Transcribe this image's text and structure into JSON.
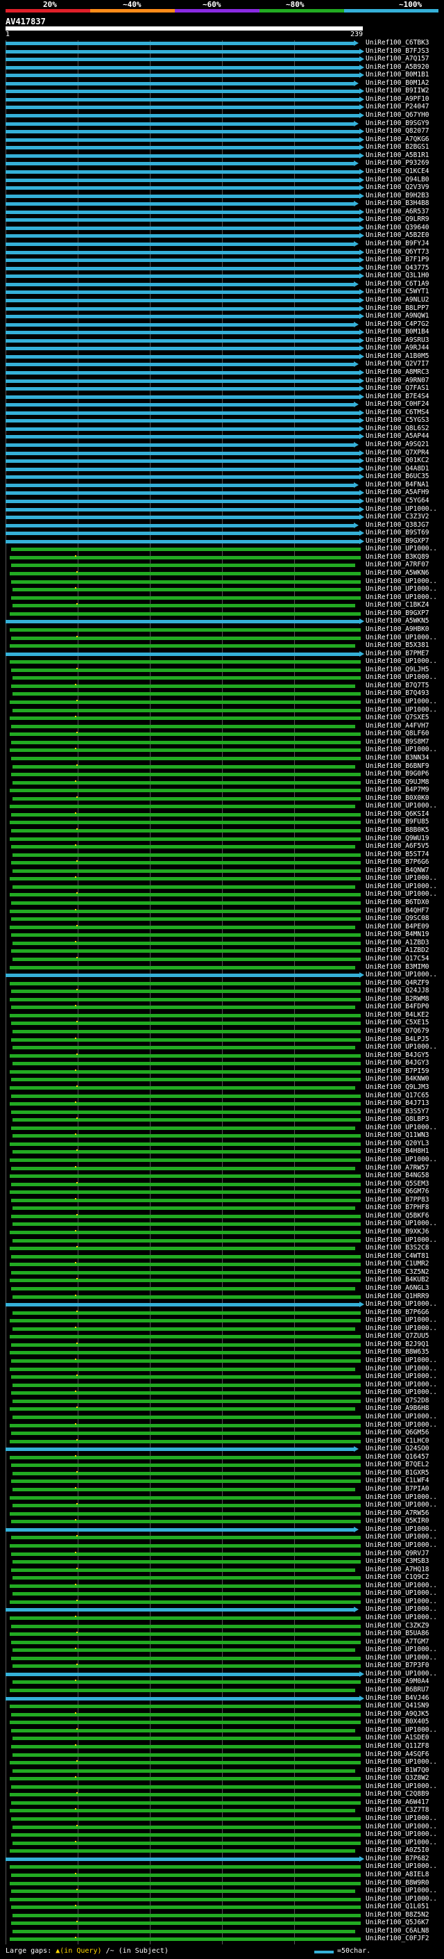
{
  "scale": {
    "labels": [
      "20%",
      "~40%",
      "~60%",
      "~80%",
      "~100%"
    ],
    "colors": [
      "#e0202a",
      "#ff8c1a",
      "#8a2be2",
      "#22aa22",
      "#35b0d8"
    ]
  },
  "query": {
    "id": "AV417837",
    "start_tick": "1",
    "end_tick": "239"
  },
  "legend": {
    "large_gaps": "Large gaps:",
    "in_query_symbol": "▲(in Query)",
    "in_subject_symbol": "/~ (in Subject)",
    "chars_label": "=50char."
  },
  "hits": [
    {
      "label": "UniRef100_C6TBK3",
      "identity": "~100%"
    },
    {
      "label": "UniRef100_B7FJS3",
      "identity": "~100%"
    },
    {
      "label": "UniRef100_A7Q157",
      "identity": "~100%"
    },
    {
      "label": "UniRef100_A5B920",
      "identity": "~100%"
    },
    {
      "label": "UniRef100_B0M1B1",
      "identity": "~100%"
    },
    {
      "label": "UniRef100_B0M1A2",
      "identity": "~100%"
    },
    {
      "label": "UniRef100_B9IIW2",
      "identity": "~100%"
    },
    {
      "label": "UniRef100_A9PF10",
      "identity": "~100%"
    },
    {
      "label": "UniRef100_P24047",
      "identity": "~100%"
    },
    {
      "label": "UniRef100_Q67YH0",
      "identity": "~100%"
    },
    {
      "label": "UniRef100_B9SGY9",
      "identity": "~100%"
    },
    {
      "label": "UniRef100_Q82077",
      "identity": "~100%"
    },
    {
      "label": "UniRef100_A7QKG6",
      "identity": "~100%"
    },
    {
      "label": "UniRef100_B2BGS1",
      "identity": "~100%"
    },
    {
      "label": "UniRef100_A5B1R1",
      "identity": "~100%"
    },
    {
      "label": "UniRef100_P93269",
      "identity": "~100%"
    },
    {
      "label": "UniRef100_Q1KCE4",
      "identity": "~100%"
    },
    {
      "label": "UniRef100_Q94LB0",
      "identity": "~100%"
    },
    {
      "label": "UniRef100_Q2V3V9",
      "identity": "~100%"
    },
    {
      "label": "UniRef100_B9H2B3",
      "identity": "~100%"
    },
    {
      "label": "UniRef100_B3H4B8",
      "identity": "~100%"
    },
    {
      "label": "UniRef100_A6R537",
      "identity": "~100%"
    },
    {
      "label": "UniRef100_Q9LRR9",
      "identity": "~100%"
    },
    {
      "label": "UniRef100_Q39640",
      "identity": "~100%"
    },
    {
      "label": "UniRef100_A5B2E0",
      "identity": "~100%"
    },
    {
      "label": "UniRef100_B9FYJ4",
      "identity": "~100%"
    },
    {
      "label": "UniRef100_Q6YT73",
      "identity": "~100%"
    },
    {
      "label": "UniRef100_B7F1P9",
      "identity": "~100%"
    },
    {
      "label": "UniRef100_Q43775",
      "identity": "~100%"
    },
    {
      "label": "UniRef100_Q3L1H0",
      "identity": "~100%"
    },
    {
      "label": "UniRef100_C6T1A9",
      "identity": "~100%"
    },
    {
      "label": "UniRef100_C5WYT1",
      "identity": "~100%"
    },
    {
      "label": "UniRef100_A9NLU2",
      "identity": "~100%"
    },
    {
      "label": "UniRef100_B8LPP7",
      "identity": "~100%"
    },
    {
      "label": "UniRef100_A9NQW1",
      "identity": "~100%"
    },
    {
      "label": "UniRef100_C4P7G2",
      "identity": "~100%"
    },
    {
      "label": "UniRef100_B0M1B4",
      "identity": "~100%"
    },
    {
      "label": "UniRef100_A9SRU3",
      "identity": "~100%"
    },
    {
      "label": "UniRef100_A9RJ44",
      "identity": "~100%"
    },
    {
      "label": "UniRef100_A1B0M5",
      "identity": "~100%"
    },
    {
      "label": "UniRef100_Q2V7I7",
      "identity": "~100%"
    },
    {
      "label": "UniRef100_A8MRC3",
      "identity": "~100%"
    },
    {
      "label": "UniRef100_A9RN07",
      "identity": "~100%"
    },
    {
      "label": "UniRef100_Q7FAS1",
      "identity": "~100%"
    },
    {
      "label": "UniRef100_B7E4S4",
      "identity": "~100%"
    },
    {
      "label": "UniRef100_C0HF24",
      "identity": "~100%"
    },
    {
      "label": "UniRef100_C6TMS4",
      "identity": "~100%"
    },
    {
      "label": "UniRef100_C5YGS3",
      "identity": "~100%"
    },
    {
      "label": "UniRef100_Q8L6S2",
      "identity": "~100%"
    },
    {
      "label": "UniRef100_A5AP44",
      "identity": "~100%"
    },
    {
      "label": "UniRef100_A9SQ21",
      "identity": "~100%"
    },
    {
      "label": "UniRef100_Q7XPR4",
      "identity": "~100%"
    },
    {
      "label": "UniRef100_Q01KC2",
      "identity": "~100%"
    },
    {
      "label": "UniRef100_Q4A8D1",
      "identity": "~100%"
    },
    {
      "label": "UniRef100_B6UC35",
      "identity": "~100%"
    },
    {
      "label": "UniRef100_B4FNA1",
      "identity": "~100%"
    },
    {
      "label": "UniRef100_A5AFH9",
      "identity": "~100%"
    },
    {
      "label": "UniRef100_C5YG64",
      "identity": "~100%"
    },
    {
      "label": "UniRef100_UP1000..",
      "identity": "~100%"
    },
    {
      "label": "UniRef100_C3Z3V2",
      "identity": "~100%"
    },
    {
      "label": "UniRef100_Q38JG7",
      "identity": "~100%"
    },
    {
      "label": "UniRef100_B9ST69",
      "identity": "~100%"
    },
    {
      "label": "UniRef100_B9GXP7",
      "identity": "~100%"
    },
    {
      "label": "UniRef100_UP1000..",
      "identity": "~80%"
    },
    {
      "label": "UniRef100_B3KQ89",
      "identity": "~80%"
    },
    {
      "label": "UniRef100_A7RF07",
      "identity": "~80%"
    },
    {
      "label": "UniRef100_A5WKN6",
      "identity": "~80%"
    },
    {
      "label": "UniRef100_UP1000..",
      "identity": "~80%"
    },
    {
      "label": "UniRef100_UP1000..",
      "identity": "~80%"
    },
    {
      "label": "UniRef100_UP1000..",
      "identity": "~80%"
    },
    {
      "label": "UniRef100_C1BKZ4",
      "identity": "~80%"
    },
    {
      "label": "UniRef100_B9GXP7",
      "identity": "~80%"
    },
    {
      "label": "UniRef100_A5WKN5",
      "identity": "~100%"
    },
    {
      "label": "UniRef100_A9HBK0",
      "identity": "~80%"
    },
    {
      "label": "UniRef100_UP1000..",
      "identity": "~80%"
    },
    {
      "label": "UniRef100_B5X381",
      "identity": "~80%"
    },
    {
      "label": "UniRef100_B7PME7",
      "identity": "~100%"
    },
    {
      "label": "UniRef100_UP1000..",
      "identity": "~80%"
    },
    {
      "label": "UniRef100_Q9LJH5",
      "identity": "~80%"
    },
    {
      "label": "UniRef100_UP1000..",
      "identity": "~80%"
    },
    {
      "label": "UniRef100_B7Q7T5",
      "identity": "~80%"
    },
    {
      "label": "UniRef100_B7Q493",
      "identity": "~80%"
    },
    {
      "label": "UniRef100_UP1000..",
      "identity": "~80%"
    },
    {
      "label": "UniRef100_UP1000..",
      "identity": "~80%"
    },
    {
      "label": "UniRef100_Q7SXE5",
      "identity": "~80%"
    },
    {
      "label": "UniRef100_A4FVH7",
      "identity": "~80%"
    },
    {
      "label": "UniRef100_Q8LF60",
      "identity": "~80%"
    },
    {
      "label": "UniRef100_B9S8M7",
      "identity": "~80%"
    },
    {
      "label": "UniRef100_UP1000..",
      "identity": "~80%"
    },
    {
      "label": "UniRef100_B3NN34",
      "identity": "~80%"
    },
    {
      "label": "UniRef100_B6BNF9",
      "identity": "~80%"
    },
    {
      "label": "UniRef100_B9G0P6",
      "identity": "~80%"
    },
    {
      "label": "UniRef100_Q9UJM8",
      "identity": "~80%"
    },
    {
      "label": "UniRef100_B4P7M9",
      "identity": "~80%"
    },
    {
      "label": "UniRef100_B0X0K0",
      "identity": "~80%"
    },
    {
      "label": "UniRef100_UP1000..",
      "identity": "~80%"
    },
    {
      "label": "UniRef100_Q6KSI4",
      "identity": "~80%"
    },
    {
      "label": "UniRef100_B9FU85",
      "identity": "~80%"
    },
    {
      "label": "UniRef100_B8B0K5",
      "identity": "~80%"
    },
    {
      "label": "UniRef100_Q9WU19",
      "identity": "~80%"
    },
    {
      "label": "UniRef100_A6F5V5",
      "identity": "~80%"
    },
    {
      "label": "UniRef100_B5ST74",
      "identity": "~80%"
    },
    {
      "label": "UniRef100_B7P6G6",
      "identity": "~80%"
    },
    {
      "label": "UniRef100_B4QNW7",
      "identity": "~80%"
    },
    {
      "label": "UniRef100_UP1000..",
      "identity": "~80%"
    },
    {
      "label": "UniRef100_UP1000..",
      "identity": "~80%"
    },
    {
      "label": "UniRef100_UP1000..",
      "identity": "~80%"
    },
    {
      "label": "UniRef100_B6TDX0",
      "identity": "~80%"
    },
    {
      "label": "UniRef100_B4QHF7",
      "identity": "~80%"
    },
    {
      "label": "UniRef100_Q9SC08",
      "identity": "~80%"
    },
    {
      "label": "UniRef100_B4PE09",
      "identity": "~80%"
    },
    {
      "label": "UniRef100_B4MN19",
      "identity": "~80%"
    },
    {
      "label": "UniRef100_A1ZBD3",
      "identity": "~80%"
    },
    {
      "label": "UniRef100_A1ZBD2",
      "identity": "~80%"
    },
    {
      "label": "UniRef100_Q17C54",
      "identity": "~80%"
    },
    {
      "label": "UniRef100_B3MIM0",
      "identity": "~80%"
    },
    {
      "label": "UniRef100_UP1000..",
      "identity": "~100%"
    },
    {
      "label": "UniRef100_Q4RZF9",
      "identity": "~80%"
    },
    {
      "label": "UniRef100_Q24JJ8",
      "identity": "~80%"
    },
    {
      "label": "UniRef100_B2RWM8",
      "identity": "~80%"
    },
    {
      "label": "UniRef100_B4FDP0",
      "identity": "~80%"
    },
    {
      "label": "UniRef100_B4LKE2",
      "identity": "~80%"
    },
    {
      "label": "UniRef100_C5XE15",
      "identity": "~80%"
    },
    {
      "label": "UniRef100_Q7Q679",
      "identity": "~80%"
    },
    {
      "label": "UniRef100_B4LPJ5",
      "identity": "~80%"
    },
    {
      "label": "UniRef100_UP1000..",
      "identity": "~80%"
    },
    {
      "label": "UniRef100_B4JGY5",
      "identity": "~80%"
    },
    {
      "label": "UniRef100_B4JGY3",
      "identity": "~80%"
    },
    {
      "label": "UniRef100_B7PI59",
      "identity": "~80%"
    },
    {
      "label": "UniRef100_B4KNW0",
      "identity": "~80%"
    },
    {
      "label": "UniRef100_Q9LJM3",
      "identity": "~80%"
    },
    {
      "label": "UniRef100_Q17C65",
      "identity": "~80%"
    },
    {
      "label": "UniRef100_B4J713",
      "identity": "~80%"
    },
    {
      "label": "UniRef100_B3S5Y7",
      "identity": "~80%"
    },
    {
      "label": "UniRef100_Q8LBP3",
      "identity": "~80%"
    },
    {
      "label": "UniRef100_UP1000..",
      "identity": "~80%"
    },
    {
      "label": "UniRef100_Q11WN3",
      "identity": "~80%"
    },
    {
      "label": "UniRef100_Q20YL3",
      "identity": "~80%"
    },
    {
      "label": "UniRef100_B4H8H1",
      "identity": "~80%"
    },
    {
      "label": "UniRef100_UP1000..",
      "identity": "~80%"
    },
    {
      "label": "UniRef100_A7RW57",
      "identity": "~80%"
    },
    {
      "label": "UniRef100_B4NG58",
      "identity": "~80%"
    },
    {
      "label": "UniRef100_Q5SEM3",
      "identity": "~80%"
    },
    {
      "label": "UniRef100_Q6GM76",
      "identity": "~80%"
    },
    {
      "label": "UniRef100_B7PP83",
      "identity": "~80%"
    },
    {
      "label": "UniRef100_B7PHF8",
      "identity": "~80%"
    },
    {
      "label": "UniRef100_Q5BKF6",
      "identity": "~80%"
    },
    {
      "label": "UniRef100_UP1000..",
      "identity": "~80%"
    },
    {
      "label": "UniRef100_B9XKJ6",
      "identity": "~80%"
    },
    {
      "label": "UniRef100_UP1000..",
      "identity": "~80%"
    },
    {
      "label": "UniRef100_B3S2C8",
      "identity": "~80%"
    },
    {
      "label": "UniRef100_C4WT81",
      "identity": "~80%"
    },
    {
      "label": "UniRef100_C1UMR2",
      "identity": "~80%"
    },
    {
      "label": "UniRef100_C3Z5N2",
      "identity": "~80%"
    },
    {
      "label": "UniRef100_B4KUB2",
      "identity": "~80%"
    },
    {
      "label": "UniRef100_A6NGL3",
      "identity": "~80%"
    },
    {
      "label": "UniRef100_Q1HRR9",
      "identity": "~80%"
    },
    {
      "label": "UniRef100_UP1000..",
      "identity": "~100%"
    },
    {
      "label": "UniRef100_B7P6G6",
      "identity": "~80%"
    },
    {
      "label": "UniRef100_UP1000..",
      "identity": "~80%"
    },
    {
      "label": "UniRef100_UP1000..",
      "identity": "~80%"
    },
    {
      "label": "UniRef100_Q7ZUU5",
      "identity": "~80%"
    },
    {
      "label": "UniRef100_B2J9Q1",
      "identity": "~80%"
    },
    {
      "label": "UniRef100_B8W635",
      "identity": "~80%"
    },
    {
      "label": "UniRef100_UP1000..",
      "identity": "~80%"
    },
    {
      "label": "UniRef100_UP1000..",
      "identity": "~80%"
    },
    {
      "label": "UniRef100_UP1000..",
      "identity": "~80%"
    },
    {
      "label": "UniRef100_UP1000..",
      "identity": "~80%"
    },
    {
      "label": "UniRef100_UP1000..",
      "identity": "~80%"
    },
    {
      "label": "UniRef100_Q7S2D8",
      "identity": "~80%"
    },
    {
      "label": "UniRef100_A9B6H8",
      "identity": "~80%"
    },
    {
      "label": "UniRef100_UP1000..",
      "identity": "~80%"
    },
    {
      "label": "UniRef100_UP1000..",
      "identity": "~80%"
    },
    {
      "label": "UniRef100_Q6GM56",
      "identity": "~80%"
    },
    {
      "label": "UniRef100_C1LHC0",
      "identity": "~80%"
    },
    {
      "label": "UniRef100_Q24SO0",
      "identity": "~100%"
    },
    {
      "label": "UniRef100_Q16457",
      "identity": "~80%"
    },
    {
      "label": "UniRef100_B7QEL2",
      "identity": "~80%"
    },
    {
      "label": "UniRef100_B1GXR5",
      "identity": "~80%"
    },
    {
      "label": "UniRef100_C1LWF4",
      "identity": "~80%"
    },
    {
      "label": "UniRef100_B7PIA0",
      "identity": "~80%"
    },
    {
      "label": "UniRef100_UP1000..",
      "identity": "~80%"
    },
    {
      "label": "UniRef100_UP1000..",
      "identity": "~80%"
    },
    {
      "label": "UniRef100_A7RW56",
      "identity": "~80%"
    },
    {
      "label": "UniRef100_Q5KIR0",
      "identity": "~80%"
    },
    {
      "label": "UniRef100_UP1000..",
      "identity": "~100%"
    },
    {
      "label": "UniRef100_UP1000..",
      "identity": "~80%"
    },
    {
      "label": "UniRef100_UP1000..",
      "identity": "~80%"
    },
    {
      "label": "UniRef100_Q9RVJ7",
      "identity": "~80%"
    },
    {
      "label": "UniRef100_C3MSB3",
      "identity": "~80%"
    },
    {
      "label": "UniRef100_A7HQ18",
      "identity": "~80%"
    },
    {
      "label": "UniRef100_C1Q9C2",
      "identity": "~80%"
    },
    {
      "label": "UniRef100_UP1000..",
      "identity": "~80%"
    },
    {
      "label": "UniRef100_UP1000..",
      "identity": "~80%"
    },
    {
      "label": "UniRef100_UP1000..",
      "identity": "~80%"
    },
    {
      "label": "UniRef100_UP1000..",
      "identity": "~100%"
    },
    {
      "label": "UniRef100_UP1000..",
      "identity": "~80%"
    },
    {
      "label": "UniRef100_C3ZKZ9",
      "identity": "~80%"
    },
    {
      "label": "UniRef100_B5UA86",
      "identity": "~80%"
    },
    {
      "label": "UniRef100_A7TGM7",
      "identity": "~80%"
    },
    {
      "label": "UniRef100_UP1000..",
      "identity": "~80%"
    },
    {
      "label": "UniRef100_UP1000..",
      "identity": "~80%"
    },
    {
      "label": "UniRef100_B7P3F0",
      "identity": "~80%"
    },
    {
      "label": "UniRef100_UP1000..",
      "identity": "~100%"
    },
    {
      "label": "UniRef100_A9M0A4",
      "identity": "~80%"
    },
    {
      "label": "UniRef100_B6BRU7",
      "identity": "~80%"
    },
    {
      "label": "UniRef100_B4VJ46",
      "identity": "~100%"
    },
    {
      "label": "UniRef100_Q41SN9",
      "identity": "~80%"
    },
    {
      "label": "UniRef100_A9QJK5",
      "identity": "~80%"
    },
    {
      "label": "UniRef100_B0X405",
      "identity": "~80%"
    },
    {
      "label": "UniRef100_UP1000..",
      "identity": "~80%"
    },
    {
      "label": "UniRef100_A1SDE0",
      "identity": "~80%"
    },
    {
      "label": "UniRef100_Q11ZF8",
      "identity": "~80%"
    },
    {
      "label": "UniRef100_A4SQF6",
      "identity": "~80%"
    },
    {
      "label": "UniRef100_UP1000..",
      "identity": "~80%"
    },
    {
      "label": "UniRef100_B1W7Q0",
      "identity": "~80%"
    },
    {
      "label": "UniRef100_Q3Z8W2",
      "identity": "~80%"
    },
    {
      "label": "UniRef100_UP1000..",
      "identity": "~80%"
    },
    {
      "label": "UniRef100_C2Q8B9",
      "identity": "~80%"
    },
    {
      "label": "UniRef100_A6W417",
      "identity": "~80%"
    },
    {
      "label": "UniRef100_C3Z7T8",
      "identity": "~80%"
    },
    {
      "label": "UniRef100_UP1000..",
      "identity": "~80%"
    },
    {
      "label": "UniRef100_UP1000..",
      "identity": "~80%"
    },
    {
      "label": "UniRef100_UP1000..",
      "identity": "~80%"
    },
    {
      "label": "UniRef100_UP1000..",
      "identity": "~80%"
    },
    {
      "label": "UniRef100_A0Z5I0",
      "identity": "~80%"
    },
    {
      "label": "UniRef100_B7P682",
      "identity": "~100%"
    },
    {
      "label": "UniRef100_UP1000..",
      "identity": "~80%"
    },
    {
      "label": "UniRef100_A8IEL8",
      "identity": "~80%"
    },
    {
      "label": "UniRef100_B8W9R0",
      "identity": "~80%"
    },
    {
      "label": "UniRef100_UP1000..",
      "identity": "~80%"
    },
    {
      "label": "UniRef100_UP1000..",
      "identity": "~80%"
    },
    {
      "label": "UniRef100_Q1L051",
      "identity": "~80%"
    },
    {
      "label": "UniRef100_B8Z5N2",
      "identity": "~80%"
    },
    {
      "label": "UniRef100_Q5J6K7",
      "identity": "~80%"
    },
    {
      "label": "UniRef100_C6ALN8",
      "identity": "~80%"
    },
    {
      "label": "UniRef100_C0FJF2",
      "identity": "~80%"
    }
  ]
}
